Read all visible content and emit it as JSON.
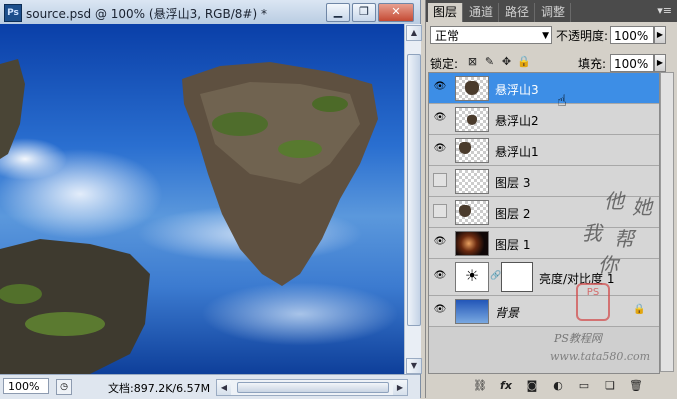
{
  "document": {
    "title": "source.psd @ 100% (悬浮山3, RGB/8#) *",
    "app_icon": "Ps",
    "window_buttons": [
      {
        "icon": "minimize-icon",
        "glyph": "▁"
      },
      {
        "icon": "restore-icon",
        "glyph": "❐"
      },
      {
        "icon": "close-icon",
        "glyph": "✕"
      }
    ],
    "zoom": "100%",
    "doc_info": "文档:897.2K/6.57M"
  },
  "panel": {
    "tabs": [
      "图层",
      "通道",
      "路径",
      "调整"
    ],
    "active_tab": "图层",
    "menu_glyph": "▾≡",
    "blend_mode": "正常",
    "opacity_label": "不透明度:",
    "opacity_value": "100%",
    "lock_label": "锁定:",
    "fill_label": "填充:",
    "fill_value": "100%",
    "layers": [
      {
        "name": "悬浮山3",
        "visible": true,
        "selected": true
      },
      {
        "name": "悬浮山2",
        "visible": true,
        "selected": false
      },
      {
        "name": "悬浮山1",
        "visible": true,
        "selected": false
      },
      {
        "name": "图层 3",
        "visible": false,
        "selected": false
      },
      {
        "name": "图层 2",
        "visible": false,
        "selected": false
      },
      {
        "name": "图层 1",
        "visible": true,
        "selected": false
      },
      {
        "name": "亮度/对比度 1",
        "visible": true,
        "selected": false
      },
      {
        "name": "背景",
        "visible": true,
        "selected": false
      }
    ],
    "bottom_icons": [
      "link-icon",
      "fx-icon",
      "mask-icon",
      "adjustment-icon",
      "group-icon",
      "new-layer-icon",
      "trash-icon"
    ]
  },
  "watermark": {
    "chars": [
      "他",
      "她",
      "我",
      "帮",
      "你"
    ],
    "seal": "PS",
    "site_name": "PS教程网",
    "site_url": "www.tata580.com"
  }
}
